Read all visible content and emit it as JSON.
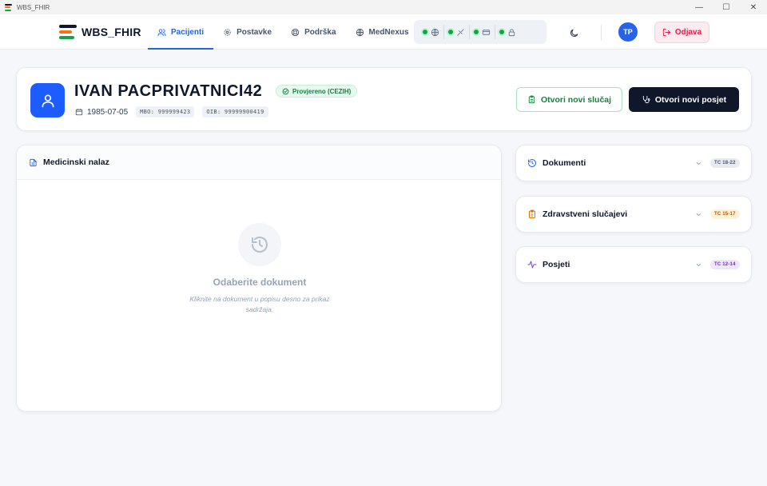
{
  "window": {
    "title": "WBS_FHIR",
    "controls": [
      "—",
      "☐",
      "✕"
    ]
  },
  "brand": {
    "name": "WBS_FHIR",
    "logo_colors": [
      "#0f172a",
      "#f97316",
      "#16a34a"
    ]
  },
  "nav": {
    "tabs": [
      {
        "label": "Pacijenti",
        "icon": "users-icon",
        "active": true
      },
      {
        "label": "Postavke",
        "icon": "gear-icon",
        "active": false
      },
      {
        "label": "Podrška",
        "icon": "lifebuoy-icon",
        "active": false
      },
      {
        "label": "MedNexus",
        "icon": "globe-icon",
        "active": false
      }
    ],
    "status_indicators": [
      {
        "icon": "globe-icon",
        "status": "online"
      },
      {
        "icon": "signature-icon",
        "status": "online"
      },
      {
        "icon": "card-icon",
        "status": "online"
      },
      {
        "icon": "lock-icon",
        "status": "online"
      }
    ],
    "theme_icon": "moon-icon",
    "avatar_initials": "TP",
    "logout_label": "Odjava"
  },
  "patient": {
    "name": "IVAN PACPRIVATNICI42",
    "verified_label": "Provjereno (CEZIH)",
    "dob": "1985-07-05",
    "mbo": "MBO: 999999423",
    "oib": "OIB: 99999900419",
    "open_case_label": "Otvori novi slučaj",
    "open_visit_label": "Otvori novi posjet"
  },
  "findings": {
    "title": "Medicinski nalaz",
    "empty_title": "Odaberite dokument",
    "empty_text": "Kliknite na dokument u popisu desno za prikaz sadržaja."
  },
  "sections": [
    {
      "title": "Dokumenti",
      "badge": "TC 18-22",
      "icon": "history-icon",
      "accent": "#475569",
      "badge_bg": "#e7eaef",
      "badge_fg": "#475569"
    },
    {
      "title": "Zdravstveni slučajevi",
      "badge": "TC 15-17",
      "icon": "clipboard-icon",
      "accent": "#d97706",
      "badge_bg": "#fdf1d6",
      "badge_fg": "#b45309"
    },
    {
      "title": "Posjeti",
      "badge": "TC 12-14",
      "icon": "activity-icon",
      "accent": "#7c3aed",
      "badge_bg": "#efe6fd",
      "badge_fg": "#6d28d9"
    }
  ],
  "colors": {
    "primary": "#2563eb",
    "success": "#16a34a",
    "danger": "#e11d48",
    "dark": "#0f172a"
  }
}
